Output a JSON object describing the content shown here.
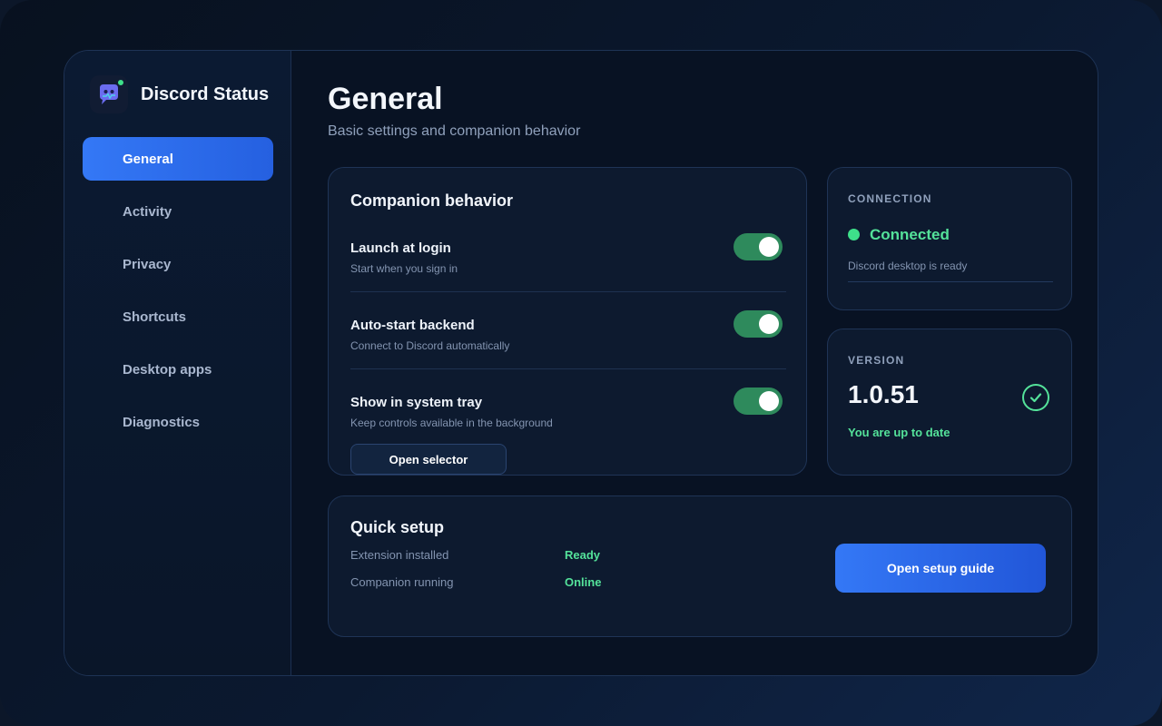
{
  "app": {
    "name": "Discord Status",
    "icon": "discord-bot-icon",
    "status_color": "#3ee08a"
  },
  "sidebar": {
    "items": [
      {
        "label": "General",
        "active": true
      },
      {
        "label": "Activity",
        "active": false
      },
      {
        "label": "Privacy",
        "active": false
      },
      {
        "label": "Shortcuts",
        "active": false
      },
      {
        "label": "Desktop apps",
        "active": false
      },
      {
        "label": "Diagnostics",
        "active": false
      }
    ]
  },
  "page": {
    "title": "General",
    "subtitle": "Basic settings and companion behavior"
  },
  "behavior": {
    "title": "Companion behavior",
    "settings": [
      {
        "label": "Launch at login",
        "desc": "Start when you sign in",
        "enabled": true
      },
      {
        "label": "Auto-start backend",
        "desc": "Connect to Discord automatically",
        "enabled": true
      },
      {
        "label": "Show in system tray",
        "desc": "Keep controls available in the background",
        "enabled": true
      }
    ],
    "selector_button": "Open selector"
  },
  "connection": {
    "heading": "CONNECTION",
    "status": "Connected",
    "desc": "Discord desktop is ready"
  },
  "version": {
    "heading": "VERSION",
    "number": "1.0.51",
    "status": "You are up to date"
  },
  "quick_setup": {
    "title": "Quick setup",
    "rows": [
      {
        "label": "Extension installed",
        "value": "Ready"
      },
      {
        "label": "Companion running",
        "value": "Online"
      }
    ],
    "button": "Open setup guide"
  },
  "colors": {
    "accent": "#3478f6",
    "success": "#54e29a",
    "toggle_on": "#2e8a5c"
  }
}
